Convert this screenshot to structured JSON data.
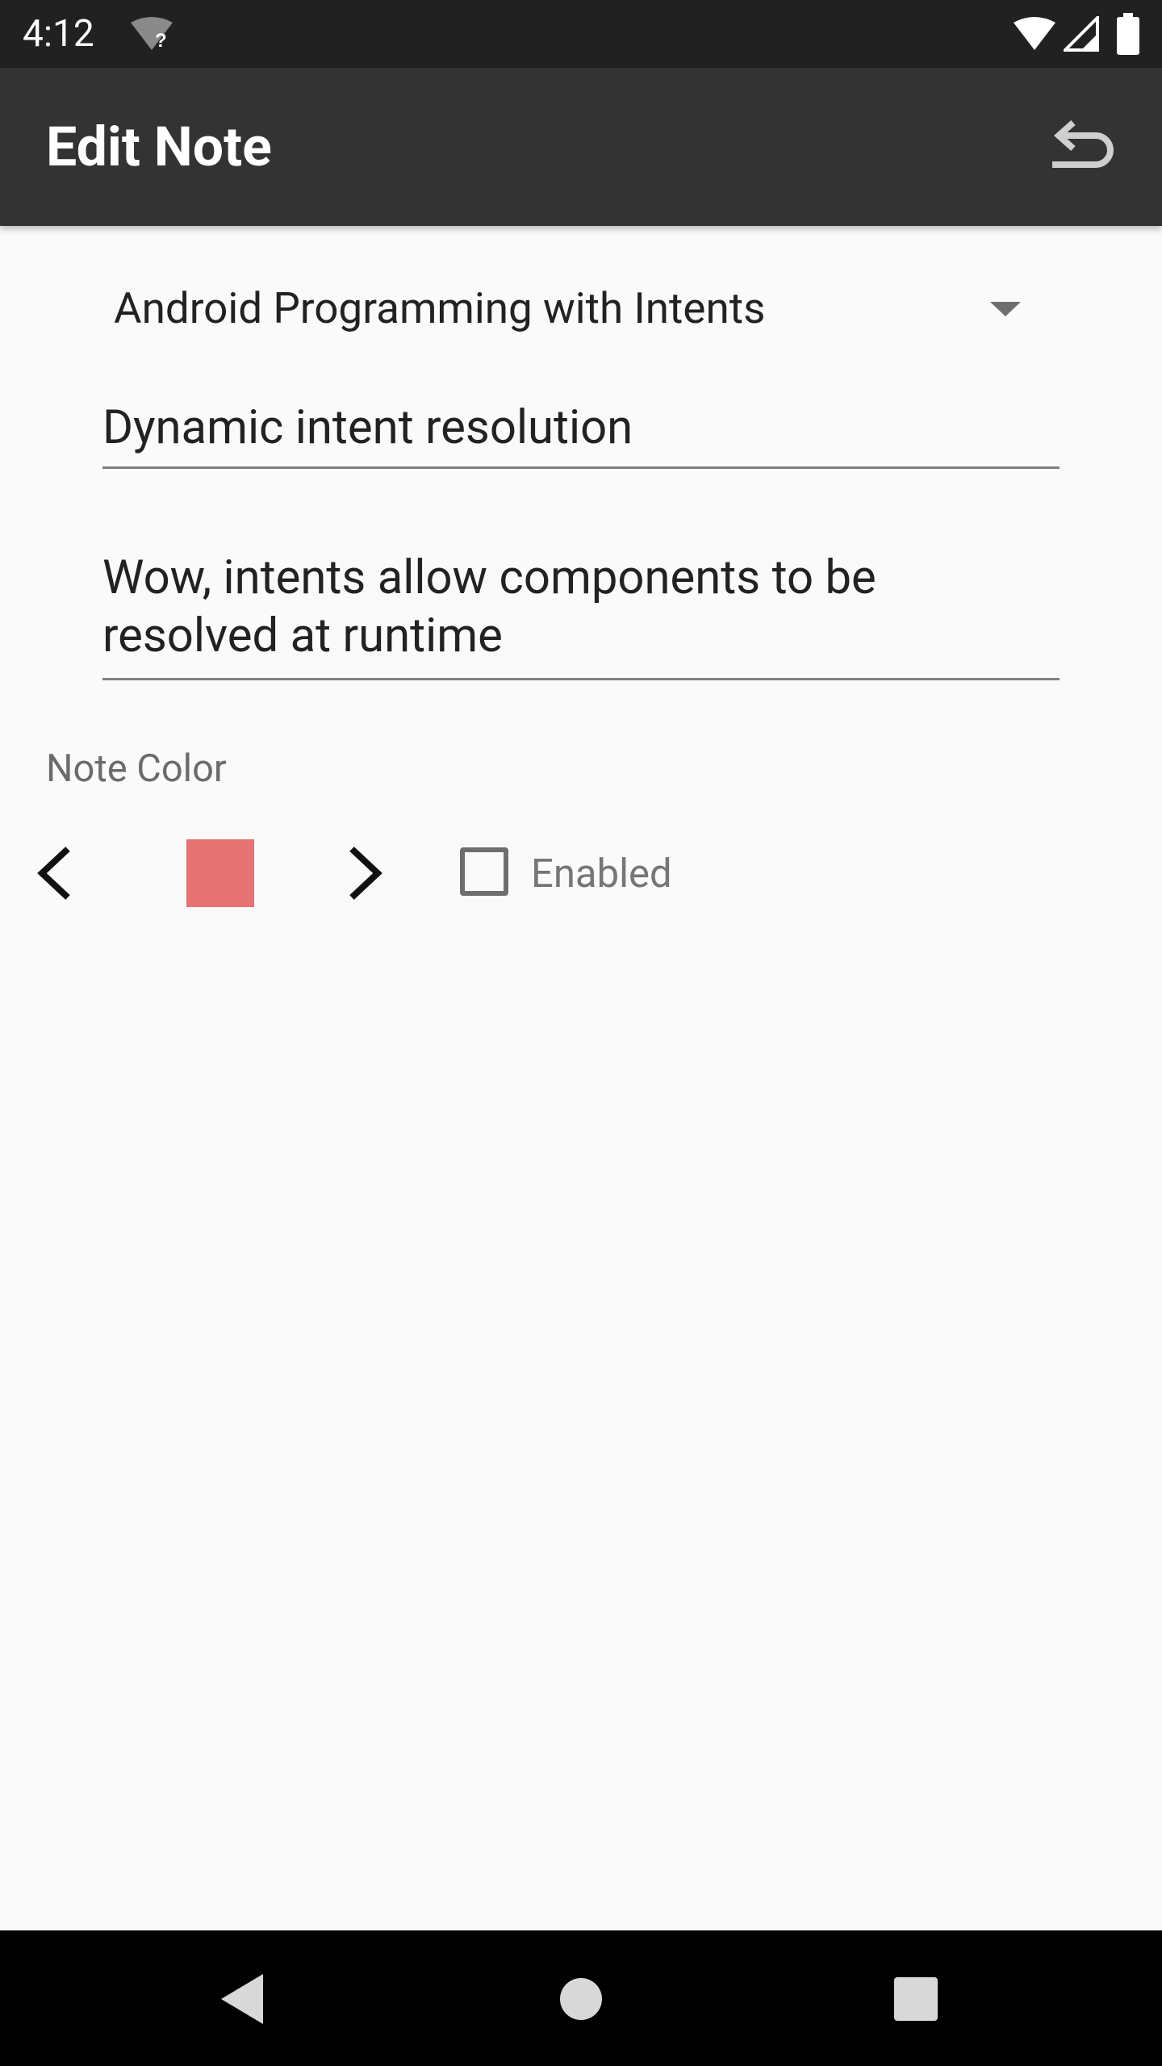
{
  "status_bar": {
    "time": "4:12",
    "icons": [
      "wifi-unknown-icon",
      "wifi-signal-icon",
      "cell-signal-icon",
      "battery-icon"
    ]
  },
  "app_bar": {
    "title": "Edit Note",
    "action_icon": "undo-icon"
  },
  "course_spinner": {
    "selected": "Android Programming with Intents"
  },
  "note_title": {
    "value": "Dynamic intent resolution"
  },
  "note_text": {
    "value": "Wow, intents allow components to be resolved at runtime"
  },
  "note_color": {
    "label": "Note Color",
    "color": "#e57373"
  },
  "enabled_checkbox": {
    "label": "Enabled",
    "checked": false
  },
  "navigation_bar": {
    "buttons": [
      "back-icon",
      "home-icon",
      "recents-icon"
    ]
  }
}
